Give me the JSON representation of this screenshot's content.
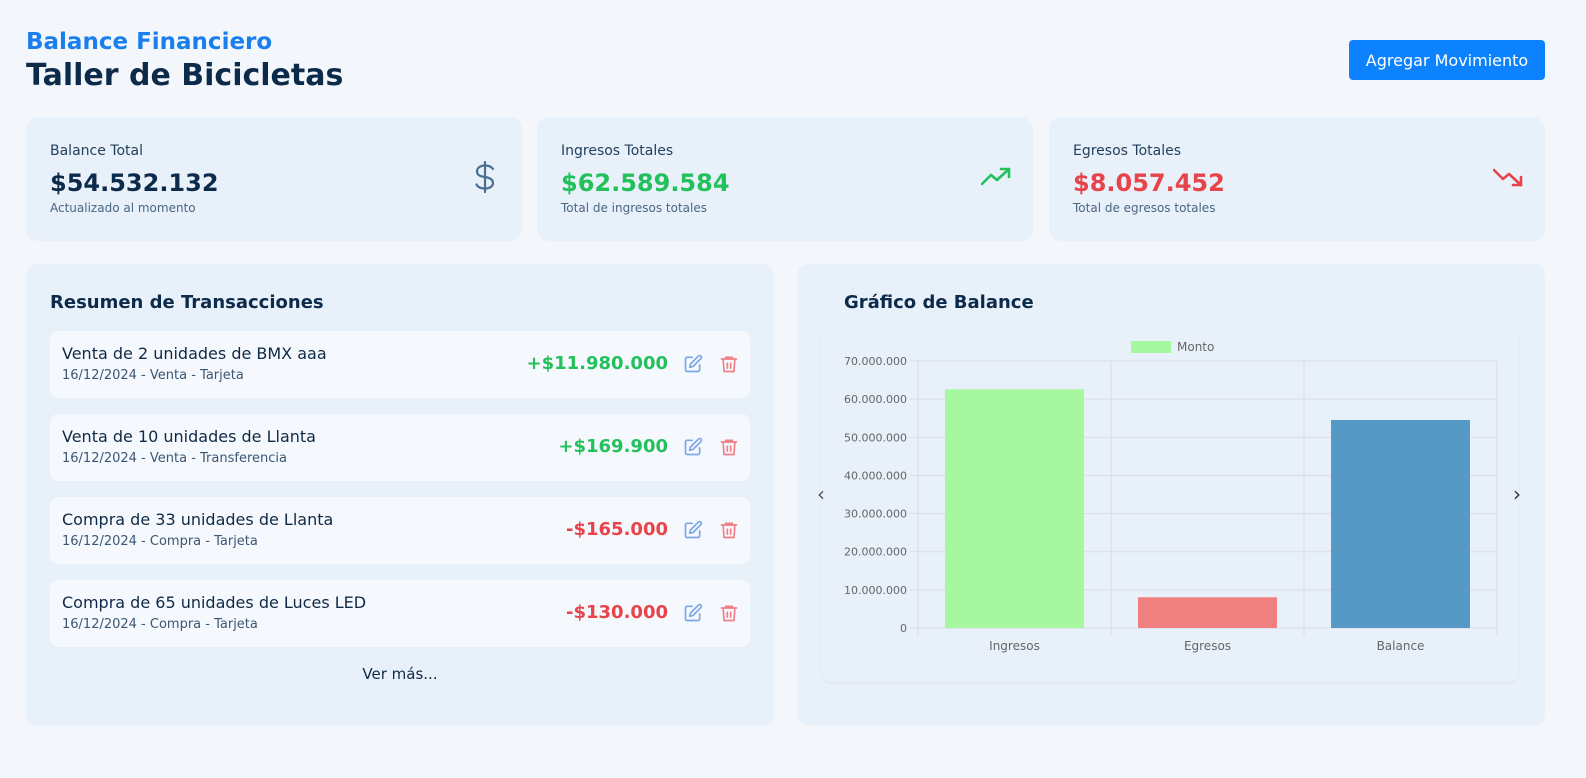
{
  "header": {
    "subtitle": "Balance Financiero",
    "title": "Taller de Bicicletas",
    "add_button_label": "Agregar Movimiento"
  },
  "cards": [
    {
      "label": "Balance Total",
      "value": "$54.532.132",
      "sub": "Actualizado al momento",
      "icon": "dollar-icon",
      "color": "#0c2a4a"
    },
    {
      "label": "Ingresos Totales",
      "value": "$62.589.584",
      "sub": "Total de ingresos totales",
      "icon": "trending-up-icon",
      "color": "#22c15c"
    },
    {
      "label": "Egresos Totales",
      "value": "$8.057.452",
      "sub": "Total de egresos totales",
      "icon": "trending-down-icon",
      "color": "#e8434a"
    }
  ],
  "transactions": {
    "title": "Resumen de Transacciones",
    "items": [
      {
        "desc": "Venta de 2 unidades de BMX aaa",
        "meta": "16/12/2024 - Venta - Tarjeta",
        "amount": "+$11.980.000",
        "type": "income"
      },
      {
        "desc": "Venta de 10 unidades de Llanta",
        "meta": "16/12/2024 - Venta - Transferencia",
        "amount": "+$169.900",
        "type": "income"
      },
      {
        "desc": "Compra de 33 unidades de Llanta",
        "meta": "16/12/2024 - Compra - Tarjeta",
        "amount": "-$165.000",
        "type": "expense"
      },
      {
        "desc": "Compra de 65 unidades de Luces LED",
        "meta": "16/12/2024 - Compra - Tarjeta",
        "amount": "-$130.000",
        "type": "expense"
      }
    ],
    "more_label": "Ver más..."
  },
  "chart": {
    "title": "Gráfico de Balance",
    "prev_icon": "chevron-left-icon",
    "next_icon": "chevron-right-icon"
  },
  "chart_data": {
    "type": "bar",
    "categories": [
      "Ingresos",
      "Egresos",
      "Balance"
    ],
    "series": [
      {
        "name": "Monto",
        "values": [
          62589584,
          8057452,
          54532132
        ]
      }
    ],
    "colors": [
      "#a6f7a0",
      "#f08080",
      "#5699c7"
    ],
    "legend": "top",
    "ylim": [
      0,
      70000000
    ],
    "yticks": [
      "0",
      "10.000.000",
      "20.000.000",
      "30.000.000",
      "40.000.000",
      "50.000.000",
      "60.000.000",
      "70.000.000"
    ],
    "grid": true
  }
}
